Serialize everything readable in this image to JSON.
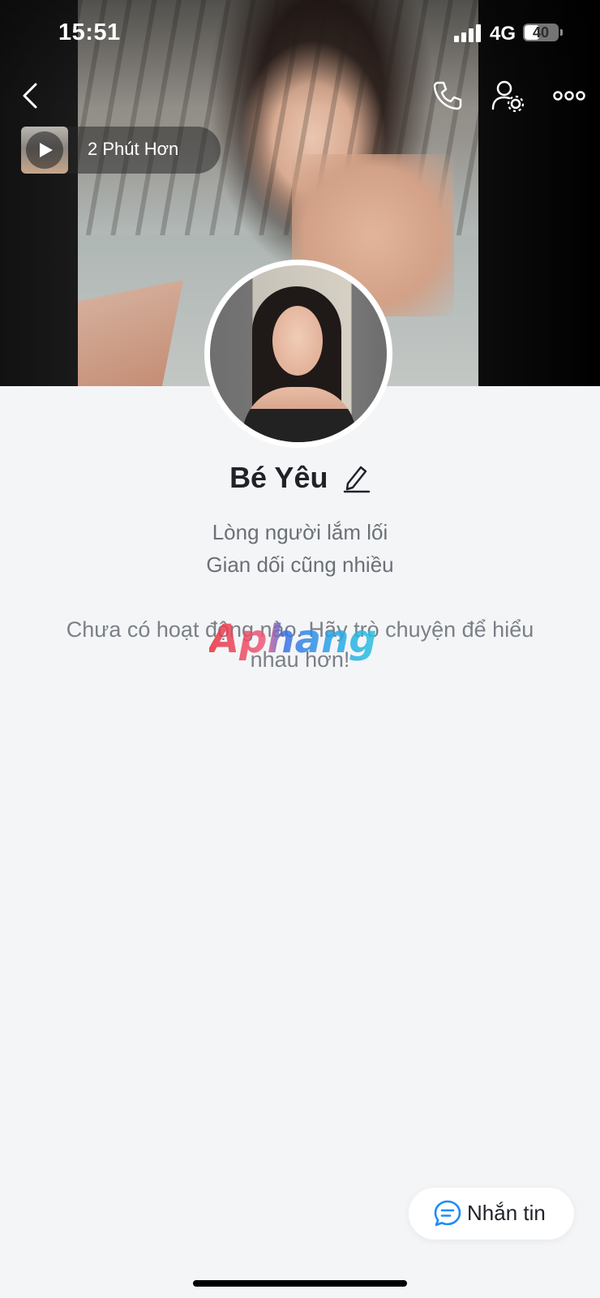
{
  "status_bar": {
    "time": "15:51",
    "network": "4G",
    "battery": "40"
  },
  "top_bar": {
    "back_icon": "chevron-left-icon",
    "call_icon": "phone-icon",
    "profile_settings_icon": "user-gear-icon",
    "more_icon": "more-horizontal-icon"
  },
  "music": {
    "title": "2 Phút Hơn",
    "play_icon": "play-icon"
  },
  "profile": {
    "name": "Bé Yêu",
    "status_line_1": "Lòng người lắm lối",
    "status_line_2": "Gian dối cũng nhiều",
    "edit_icon": "pencil-icon"
  },
  "activity": {
    "empty_message": "Chưa có hoạt động nào. Hãy trò chuyện để hiểu nhau hơn!"
  },
  "watermark": {
    "text": "Aphang"
  },
  "actions": {
    "message_label": "Nhắn tin",
    "message_icon": "chat-bubble-icon"
  },
  "colors": {
    "background": "#f4f5f7",
    "accent": "#1d8cf8",
    "text_primary": "#1f2329",
    "text_secondary": "#6b7077"
  }
}
